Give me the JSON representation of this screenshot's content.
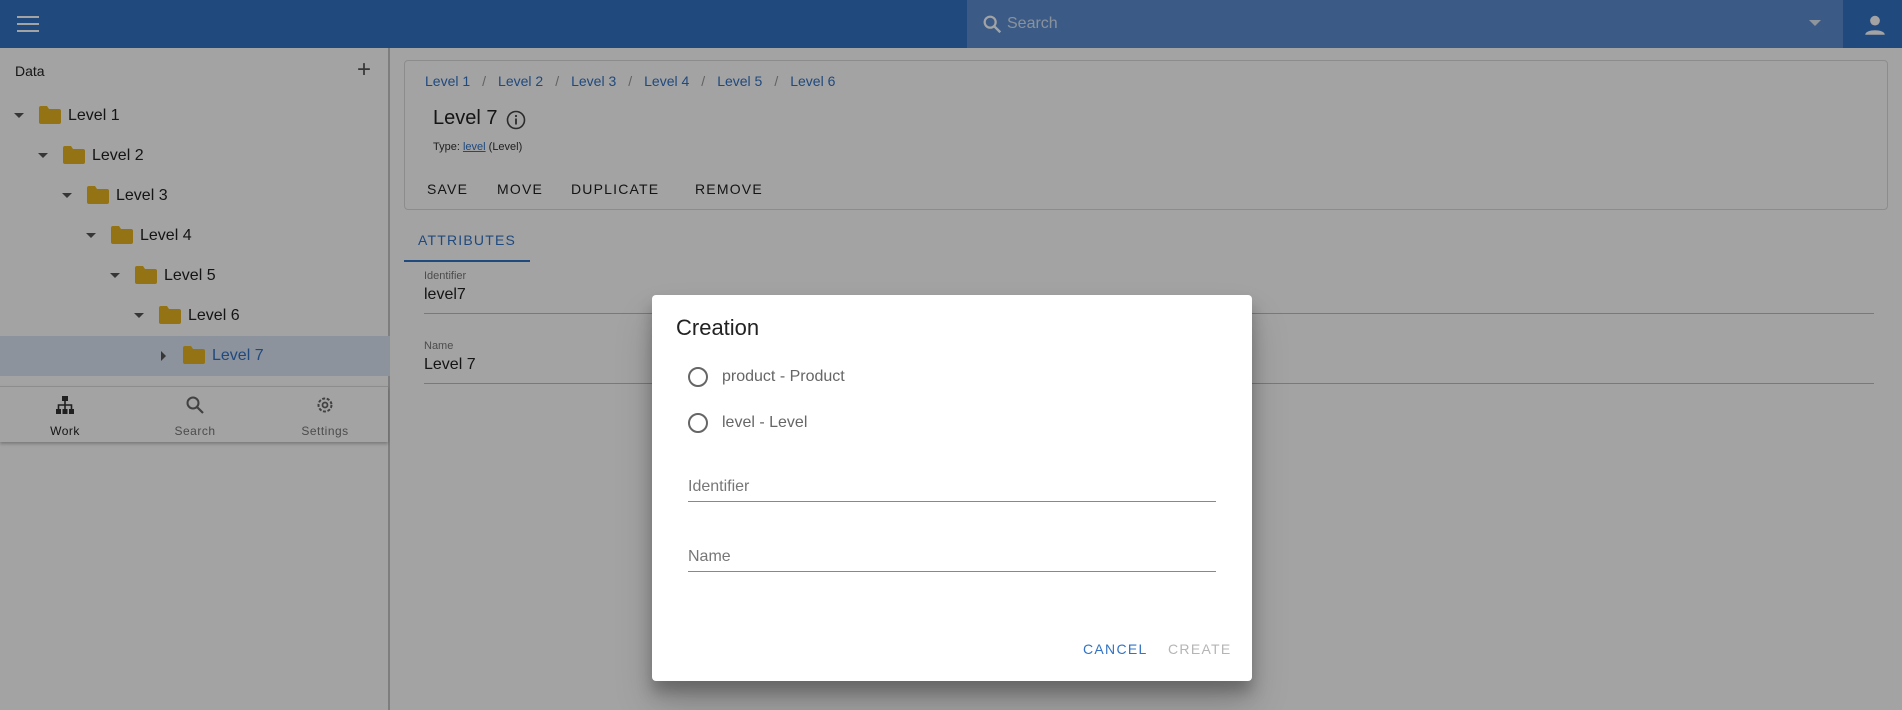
{
  "topbar": {
    "search_placeholder": "Search"
  },
  "sidebar": {
    "title": "Data",
    "tree": [
      {
        "label": "Level 1",
        "expanded": true
      },
      {
        "label": "Level 2",
        "expanded": true
      },
      {
        "label": "Level 3",
        "expanded": true
      },
      {
        "label": "Level 4",
        "expanded": true
      },
      {
        "label": "Level 5",
        "expanded": true
      },
      {
        "label": "Level 6",
        "expanded": true
      },
      {
        "label": "Level 7",
        "expanded": false,
        "selected": true
      }
    ],
    "bottom_nav": [
      {
        "label": "Work",
        "icon": "sitemap-icon",
        "active": true
      },
      {
        "label": "Search",
        "icon": "search-icon",
        "active": false
      },
      {
        "label": "Settings",
        "icon": "gear-icon",
        "active": false
      }
    ]
  },
  "main": {
    "breadcrumbs": [
      "Level 1",
      "Level 2",
      "Level 3",
      "Level 4",
      "Level 5",
      "Level 6"
    ],
    "title": "Level 7",
    "type_prefix": "Type:",
    "type_link": "level",
    "type_suffix": "(Level)",
    "actions": [
      "SAVE",
      "MOVE",
      "DUPLICATE",
      "REMOVE"
    ],
    "tab": "ATTRIBUTES",
    "fields": [
      {
        "label": "Identifier",
        "value": "level7"
      },
      {
        "label": "Name",
        "value": "Level 7"
      }
    ]
  },
  "dialog": {
    "title": "Creation",
    "options": [
      "product - Product",
      "level - Level"
    ],
    "identifier_placeholder": "Identifier",
    "name_placeholder": "Name",
    "cancel_label": "CANCEL",
    "create_label": "CREATE"
  },
  "colors": {
    "primary": "#3273c5",
    "folder": "#e8b422",
    "selected_row": "#dbe6f6",
    "disabled": "#b5b5b5"
  }
}
